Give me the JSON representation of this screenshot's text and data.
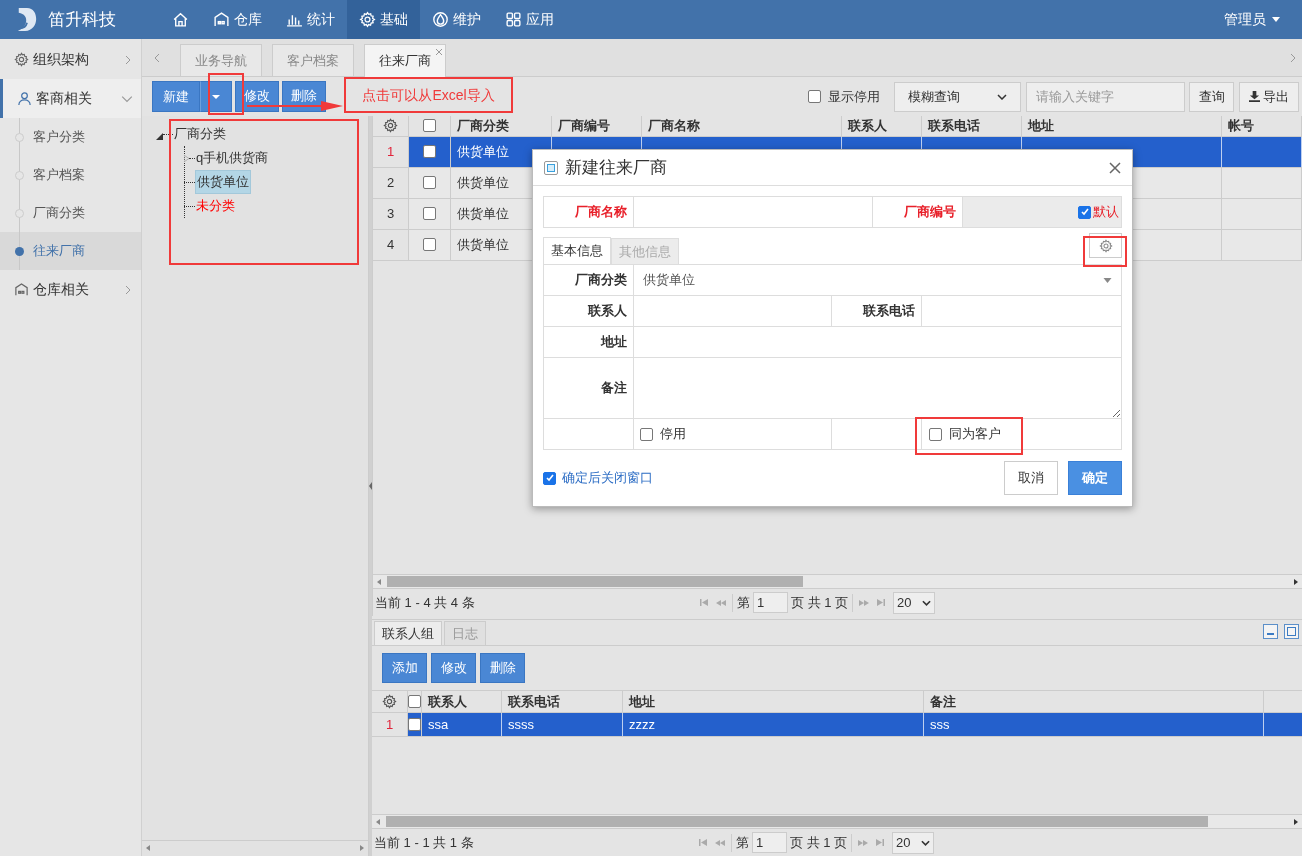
{
  "app": {
    "name": "笛升科技"
  },
  "nav": [
    {
      "kind": "home",
      "selected": false
    },
    {
      "label": "仓库",
      "kind": "warehouse",
      "selected": false
    },
    {
      "label": "统计",
      "kind": "stats",
      "selected": false
    },
    {
      "label": "基础",
      "kind": "settings",
      "selected": true
    },
    {
      "label": "维护",
      "kind": "maintain",
      "selected": false
    },
    {
      "label": "应用",
      "kind": "apps",
      "selected": false
    }
  ],
  "user": {
    "label": "管理员"
  },
  "sidebar": {
    "items": [
      {
        "label": "组织架构",
        "kind": "settings",
        "expanded": false
      },
      {
        "label": "客商相关",
        "kind": "user",
        "expanded": true,
        "children": [
          {
            "label": "客户分类",
            "selected": false
          },
          {
            "label": "客户档案",
            "selected": false
          },
          {
            "label": "厂商分类",
            "selected": false
          },
          {
            "label": "往来厂商",
            "selected": true
          }
        ]
      },
      {
        "label": "仓库相关",
        "kind": "warehouse",
        "expanded": false
      }
    ]
  },
  "tabs": [
    {
      "label": "业务导航",
      "selected": false,
      "closable": false
    },
    {
      "label": "客户档案",
      "selected": false,
      "closable": false
    },
    {
      "label": "往来厂商",
      "selected": true,
      "closable": true
    }
  ],
  "toolbar": {
    "buttons": [
      {
        "label": "新建",
        "kind": "split"
      },
      {
        "label": "修改",
        "kind": "plain"
      },
      {
        "label": "删除",
        "kind": "plain"
      }
    ],
    "show_disabled": {
      "label": "显示停用",
      "checked": false
    },
    "search_mode": {
      "value": "模糊查询"
    },
    "search": {
      "placeholder": "请输入关键字"
    },
    "query_button": "查询",
    "export_button": "导出"
  },
  "annotation": {
    "text": "点击可以从Excel导入"
  },
  "tree": {
    "label": "厂商分类",
    "expanded": true,
    "children": [
      {
        "label": "q手机供货商",
        "expandable": true,
        "selected": false,
        "color": "#333333"
      },
      {
        "label": "供货单位",
        "expandable": false,
        "selected": true,
        "color": "#333333"
      },
      {
        "label": "未分类",
        "expandable": false,
        "selected": false,
        "color": "#ff0000"
      }
    ]
  },
  "grid": {
    "all_checked": false,
    "columns": [
      "厂商分类",
      "厂商编号",
      "厂商名称",
      "联系人",
      "联系电话",
      "地址",
      "帐号"
    ],
    "rows": [
      {
        "number": "1",
        "checked": false,
        "selected": true,
        "cells": [
          "供货单位"
        ]
      },
      {
        "number": "2",
        "checked": false,
        "selected": false,
        "cells": [
          "供货单位"
        ]
      },
      {
        "number": "3",
        "checked": false,
        "selected": false,
        "cells": [
          "供货单位"
        ]
      },
      {
        "number": "4",
        "checked": false,
        "selected": false,
        "cells": [
          "供货单位"
        ]
      }
    ],
    "pager": {
      "summary": "当前 1 - 4 共 4 条",
      "page_prefix": "第",
      "page": "1",
      "page_suffix": "页 共 1 页",
      "page_size": "20"
    }
  },
  "detail": {
    "tabs": [
      {
        "label": "联系人组",
        "selected": true
      },
      {
        "label": "日志",
        "selected": false
      }
    ],
    "buttons": [
      "添加",
      "修改",
      "删除"
    ],
    "all_checked": false,
    "columns": [
      "联系人",
      "联系电话",
      "地址",
      "备注"
    ],
    "rows": [
      {
        "number": "1",
        "checked": false,
        "selected": true,
        "cells": [
          "ssa",
          "ssss",
          "zzzz",
          "sss"
        ]
      }
    ],
    "pager": {
      "summary": "当前 1 - 1 共 1 条",
      "page_prefix": "第",
      "page": "1",
      "page_suffix": "页 共 1 页",
      "page_size": "20"
    }
  },
  "dialog": {
    "title": "新建往来厂商",
    "name_label": "厂商名称",
    "code_label": "厂商编号",
    "auto_code": {
      "label": "默认",
      "checked": true
    },
    "tabs": [
      {
        "label": "基本信息",
        "selected": true
      },
      {
        "label": "其他信息",
        "selected": false
      }
    ],
    "category": {
      "label": "厂商分类",
      "value": "供货单位"
    },
    "contact_label": "联系人",
    "phone_label": "联系电话",
    "address_label": "地址",
    "remark_label": "备注",
    "disabled": {
      "label": "停用",
      "checked": false
    },
    "also_customer": {
      "label": "同为客户",
      "checked": false
    },
    "close_after": {
      "label": "确定后关闭窗口",
      "checked": true
    },
    "cancel": "取消",
    "ok": "确定"
  }
}
